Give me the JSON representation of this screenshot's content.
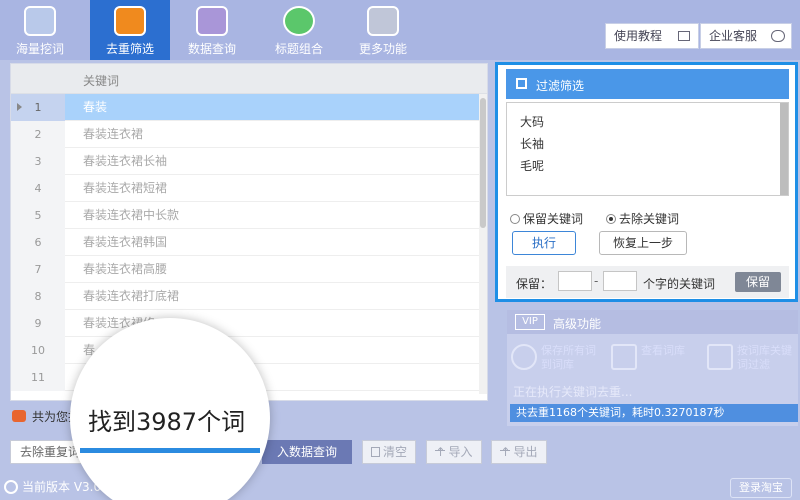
{
  "nav": {
    "items": [
      {
        "label": "海量挖词",
        "icon": "chat-icon",
        "color": "#b9c9ea"
      },
      {
        "label": "去重筛选",
        "icon": "box-icon",
        "color": "#f08a1e"
      },
      {
        "label": "数据查询",
        "icon": "bar-chart-icon",
        "color": "#a996d8"
      },
      {
        "label": "标题组合",
        "icon": "check-circle-icon",
        "color": "#5bc76b"
      },
      {
        "label": "更多功能",
        "icon": "gear-icon",
        "color": "#c0c6d8"
      }
    ],
    "tutorial_label": "使用教程",
    "service_label": "企业客服"
  },
  "table": {
    "header": "关键词",
    "rows": [
      {
        "index": "1",
        "keyword": "春装"
      },
      {
        "index": "2",
        "keyword": "春装连衣裙"
      },
      {
        "index": "3",
        "keyword": "春装连衣裙长袖"
      },
      {
        "index": "4",
        "keyword": "春装连衣裙短裙"
      },
      {
        "index": "5",
        "keyword": "春装连衣裙中长款"
      },
      {
        "index": "6",
        "keyword": "春装连衣裙韩国"
      },
      {
        "index": "7",
        "keyword": "春装连衣裙高腰"
      },
      {
        "index": "8",
        "keyword": "春装连衣裙打底裙"
      },
      {
        "index": "9",
        "keyword": "春装连衣裙修"
      },
      {
        "index": "10",
        "keyword": "春"
      },
      {
        "index": "11",
        "keyword": ""
      }
    ]
  },
  "summary": {
    "total_prefix": "共为您找"
  },
  "magnifier": {
    "text": "找到3987个词"
  },
  "buttons": {
    "dedupe": "去除重复词",
    "query": "入数据查询",
    "clear": "清空",
    "import": "导入",
    "export": "导出"
  },
  "version": "当前版本 V3.0.",
  "filter": {
    "title": "过滤筛选",
    "lines": [
      "大码",
      "长袖",
      "毛呢"
    ],
    "keep_option": "保留关键词",
    "remove_option": "去除关键词",
    "selected_option": "remove",
    "execute": "执行",
    "undo": "恢复上一步",
    "keep_label": "保留：",
    "keep_dash": "-",
    "keep_suffix": "个字的关键词",
    "keep_button": "保留"
  },
  "advanced": {
    "vip": "VIP",
    "title": "高级功能",
    "item1": "保存所有词到词库",
    "item2": "查看词库",
    "item3": "按词库关键词过滤",
    "status": "正在执行关键词去重...",
    "result": "共去重1168个关键词，耗时0.3270187秒"
  },
  "login": "登录淘宝"
}
